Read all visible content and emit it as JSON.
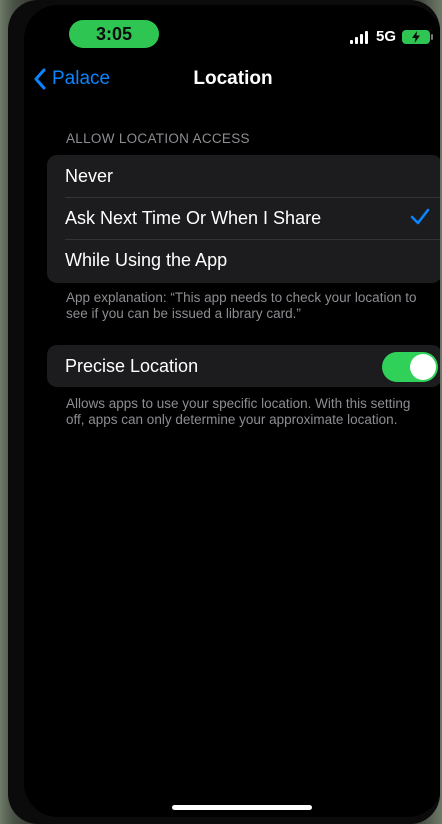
{
  "status_bar": {
    "time": "3:05",
    "network": "5G",
    "battery_icon": "battery-charging-icon",
    "accent": "#2fc553"
  },
  "nav": {
    "back_label": "Palace",
    "title": "Location",
    "back_color": "#0a84ff"
  },
  "location_access": {
    "section_header": "ALLOW LOCATION ACCESS",
    "options": [
      {
        "label": "Never",
        "selected": false
      },
      {
        "label": "Ask Next Time Or When I Share",
        "selected": true
      },
      {
        "label": "While Using the App",
        "selected": false
      }
    ],
    "explanation": "App explanation: “This app needs to check your location to see if you can be issued a library card.”"
  },
  "precise_location": {
    "label": "Precise Location",
    "enabled": true,
    "toggle_color": "#30d158",
    "description": "Allows apps to use your specific location. With this setting off, apps can only determine your approximate location."
  }
}
